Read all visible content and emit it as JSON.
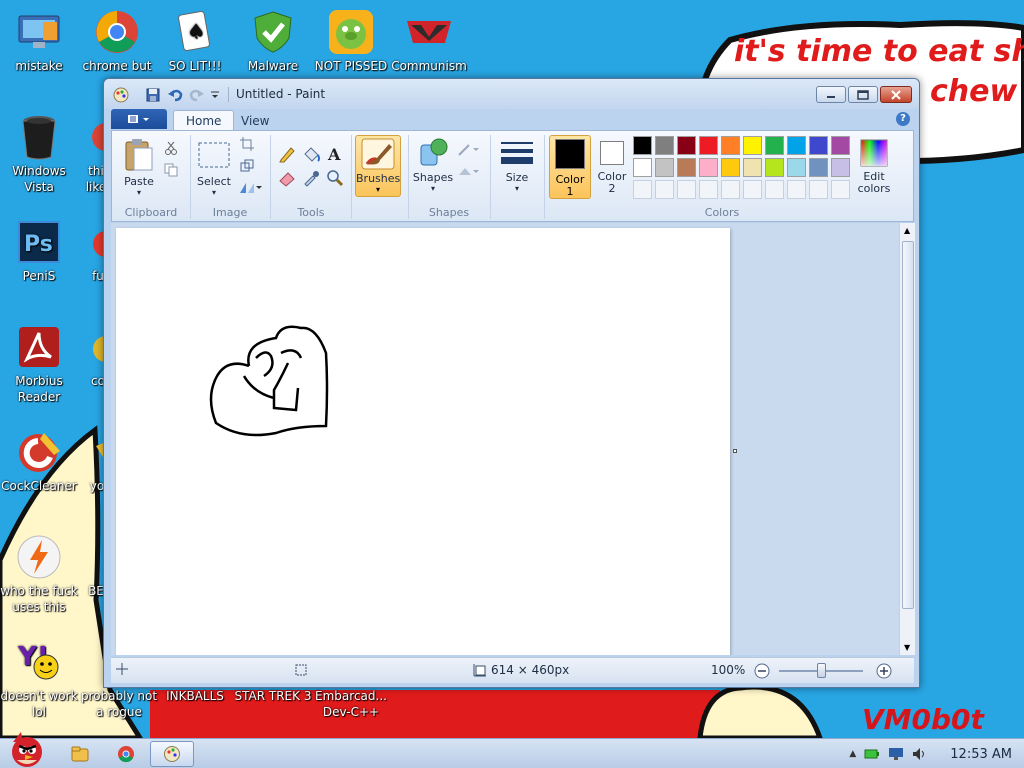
{
  "wallpaper": {
    "speech_line1": "it's time to eat shit",
    "speech_line2": "chew",
    "signature": "VM0b0t",
    "colors": {
      "sky": "#28a6e4",
      "banner": "#e01b1b",
      "cream": "#fff6c9"
    }
  },
  "desktop_icons": [
    {
      "label": "mistake",
      "icon": "computer-icon"
    },
    {
      "label": "chrome but no",
      "icon": "chrome-icon"
    },
    {
      "label": "SO LIT!!!",
      "icon": "solitaire-icon"
    },
    {
      "label": "Malware",
      "icon": "shield-icon"
    },
    {
      "label": "NOT PISSED",
      "icon": "pig-icon"
    },
    {
      "label": "Communism",
      "icon": "banner-icon"
    },
    {
      "label": "Windows Vista",
      "icon": "recycle-bin-icon"
    },
    {
      "label": "PeniS",
      "icon": "photoshop-icon"
    },
    {
      "label": "Morbius Reader",
      "icon": "pdf-reader-icon"
    },
    {
      "label": "CockCleaner",
      "icon": "cleaner-icon"
    },
    {
      "label": "who the fuck uses this",
      "icon": "winamp-icon"
    },
    {
      "label": "doesn't work lol",
      "icon": "yahoo-icon"
    },
    {
      "label": "probably not a rogue",
      "icon": "shield-app-icon"
    },
    {
      "label": "INKBALLS",
      "icon": "inkball-icon"
    },
    {
      "label": "STAR TREK 3",
      "icon": "star-trek-icon"
    },
    {
      "label": "Embarcad... Dev-C++",
      "icon": "devcpp-icon"
    },
    {
      "label": "thi like",
      "icon": "partial-icon"
    },
    {
      "label": "fu",
      "icon": "partial-icon"
    },
    {
      "label": "co",
      "icon": "partial-icon"
    },
    {
      "label": "yo",
      "icon": "partial-icon"
    },
    {
      "label": "BE",
      "icon": "partial-icon"
    }
  ],
  "paint": {
    "title": "Untitled - Paint",
    "tabs": [
      {
        "label": "Home",
        "selected": true
      },
      {
        "label": "View",
        "selected": false
      }
    ],
    "groups": {
      "clipboard": "Clipboard",
      "image": "Image",
      "tools": "Tools",
      "shapes": "Shapes",
      "colors": "Colors"
    },
    "buttons": {
      "paste": "Paste",
      "select": "Select",
      "brushes": "Brushes",
      "shapes": "Shapes",
      "size": "Size",
      "color1_line1": "Color",
      "color1_line2": "1",
      "color2_line1": "Color",
      "color2_line2": "2",
      "edit_colors_line1": "Edit",
      "edit_colors_line2": "colors"
    },
    "color1": "#000000",
    "color2": "#ffffff",
    "palette_row1": [
      "#000000",
      "#7f7f7f",
      "#880015",
      "#ed1c24",
      "#ff7f27",
      "#fff200",
      "#22b14c",
      "#00a2e8",
      "#3f48cc",
      "#a349a4"
    ],
    "palette_row2": [
      "#ffffff",
      "#c3c3c3",
      "#b97a57",
      "#ffaec9",
      "#ffc90e",
      "#efe4b0",
      "#b5e61d",
      "#99d9ea",
      "#7092be",
      "#c8bfe7"
    ],
    "status": {
      "canvas_size": "614 × 460px",
      "zoom": "100%"
    }
  },
  "taskbar": {
    "clock": "12:53 AM",
    "pinned": [
      "explorer-icon",
      "chrome-icon",
      "paint-icon"
    ]
  }
}
